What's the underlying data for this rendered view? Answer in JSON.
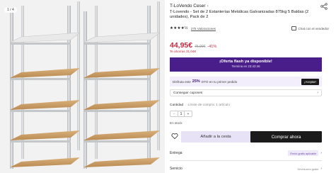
{
  "gallery": {
    "counter": "1 / 4"
  },
  "store": {
    "name": "T-LoVendo Ceser",
    "chevron": "›"
  },
  "product": {
    "title": "T-Lovendo - Set de 2 Estanterías Metálicas Galvanizadas 875kg 5 Baldas (2 unidades), Pack de 2",
    "stars": "★★★★½",
    "rating_count": "275 Valoraciones",
    "chat_label": "Chat con el vendedor"
  },
  "price": {
    "current": "44,95€",
    "original": "75,99€",
    "discount": "-41%",
    "savings": "Te ahorras 31,04€"
  },
  "flash": {
    "title": "¡Oferta flash ya disponible!",
    "subtitle": "Termina en 23:42:46"
  },
  "coupon_strip": {
    "prefix": "Disfruta este",
    "percent": "25%",
    "suffix": "DTO en tu primer pedido",
    "button": "¡Aceptar!"
  },
  "coupons": {
    "label": "Conseguir cupones",
    "chevron": "›"
  },
  "quantity": {
    "label": "Cantidad",
    "limit": "Límite de compra: 1 artículo",
    "minus": "-",
    "value": "1",
    "plus": "+"
  },
  "stock": "En stock",
  "actions": {
    "add_to_cart": "Añadir a la cesta",
    "buy_now": "Comprar ahora"
  },
  "shipping": {
    "label": "Entrega",
    "badge": "Envío gratis aplicable",
    "chevron": "›"
  },
  "service": {
    "label": "Servicio",
    "note": "Devolución gratis",
    "chevron": "›"
  },
  "colors": {
    "price_red": "#c9283f",
    "flash_purple": "#4a1e8a",
    "buy_black": "#1b1b1b",
    "cart_lavender": "#e8e2f6"
  }
}
